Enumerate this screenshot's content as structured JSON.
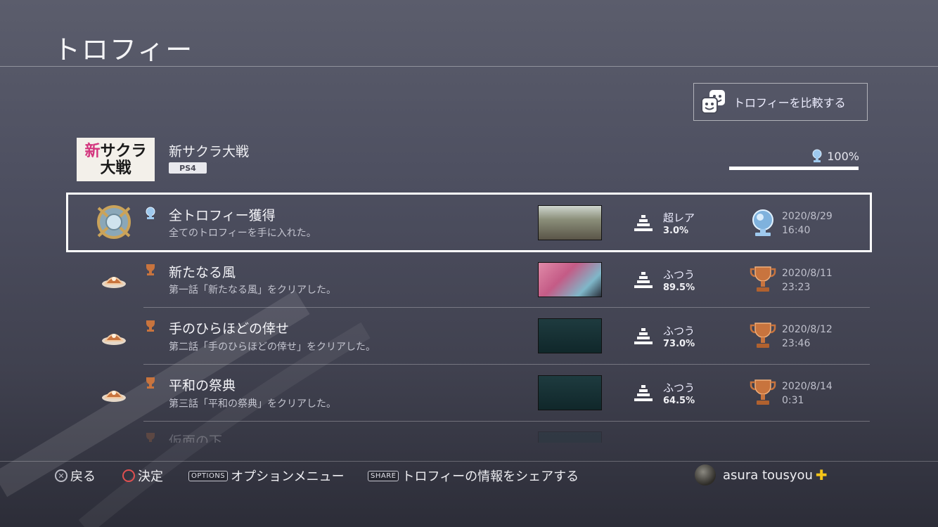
{
  "header": {
    "title": "トロフィー"
  },
  "compare_button": {
    "label": "トロフィーを比較する",
    "icon": "compare-users-icon"
  },
  "game": {
    "title": "新サクラ大戦",
    "platform": "PS4",
    "progress_percent_text": "100%",
    "progress_fraction": 1.0,
    "logo": {
      "line1_accent": "新",
      "line1_rest": "サクラ",
      "line2": "大戦"
    }
  },
  "trophies": [
    {
      "grade": "platinum",
      "name": "全トロフィー獲得",
      "description": "全てのトロフィーを手に入れた。",
      "rarity": "超レア",
      "percent": "3.0%",
      "date": "2020/8/29",
      "time": "16:40",
      "selected": true
    },
    {
      "grade": "bronze",
      "name": "新たなる風",
      "description": "第一話「新たなる風」をクリアした。",
      "rarity": "ふつう",
      "percent": "89.5%",
      "date": "2020/8/11",
      "time": "23:23"
    },
    {
      "grade": "bronze",
      "name": "手のひらほどの倖せ",
      "description": "第二話「手のひらほどの倖せ」をクリアした。",
      "rarity": "ふつう",
      "percent": "73.0%",
      "date": "2020/8/12",
      "time": "23:46"
    },
    {
      "grade": "bronze",
      "name": "平和の祭典",
      "description": "第三話「平和の祭典」をクリアした。",
      "rarity": "ふつう",
      "percent": "64.5%",
      "date": "2020/8/14",
      "time": "0:31"
    },
    {
      "grade": "bronze",
      "name": "仮面の下",
      "partial": true
    }
  ],
  "footer": {
    "back": "戻る",
    "confirm": "決定",
    "options_key": "OPTIONS",
    "options_label": "オプションメニュー",
    "share_key": "SHARE",
    "share_label": "トロフィーの情報をシェアする",
    "user": "asura tousyou"
  },
  "colors": {
    "bronze": "#c8743e",
    "platinum": "#9ec9ee",
    "selection_border": "#ffffff"
  }
}
